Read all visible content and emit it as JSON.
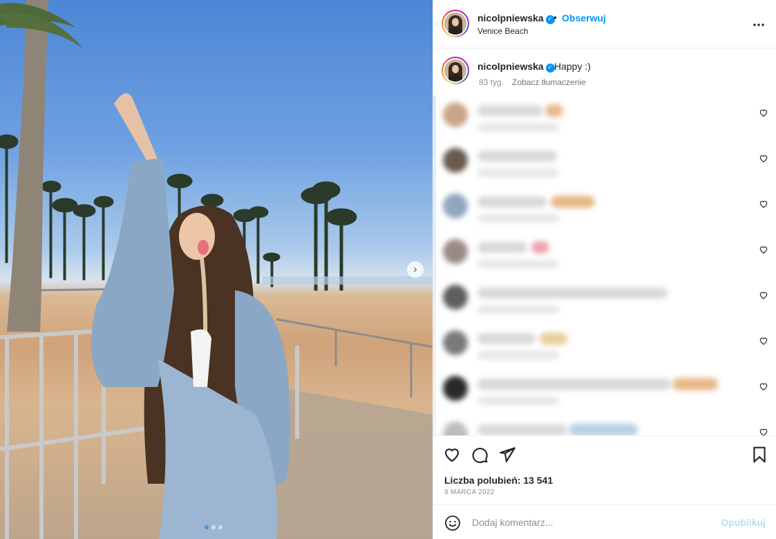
{
  "header": {
    "username": "nicolpniewska",
    "verified": true,
    "separator": "•",
    "follow_label": "Obserwuj",
    "location": "Venice Beach",
    "more_icon": "more-horizontal-icon",
    "more_label": "•••"
  },
  "caption": {
    "username": "nicolpniewska",
    "verified": true,
    "text": "Happy :)",
    "age": "83 tyg.",
    "translate_label": "Zobacz tłumaczenie"
  },
  "comments": [
    {
      "blurred": true
    },
    {
      "blurred": true
    },
    {
      "blurred": true
    },
    {
      "blurred": true
    },
    {
      "blurred": true
    },
    {
      "blurred": true
    },
    {
      "blurred": true
    },
    {
      "blurred": true
    }
  ],
  "actions": {
    "like_icon": "heart-icon",
    "comment_icon": "comment-icon",
    "share_icon": "share-icon",
    "save_icon": "bookmark-icon"
  },
  "likes_label": "Liczba polubień: 13 541",
  "date_label": "8 MARCA 2022",
  "add_comment": {
    "placeholder": "Dodaj komentarz...",
    "publish_label": "Opublikuj",
    "emoji_icon": "smiley-icon"
  },
  "photo": {
    "carousel_count": 3,
    "carousel_active": 1,
    "next_icon": "chevron-right-icon",
    "next_glyph": "›"
  },
  "colors": {
    "accent": "#0095f6",
    "text": "#262626",
    "muted": "#8e8e8e",
    "publish_disabled": "#b2dffc"
  }
}
